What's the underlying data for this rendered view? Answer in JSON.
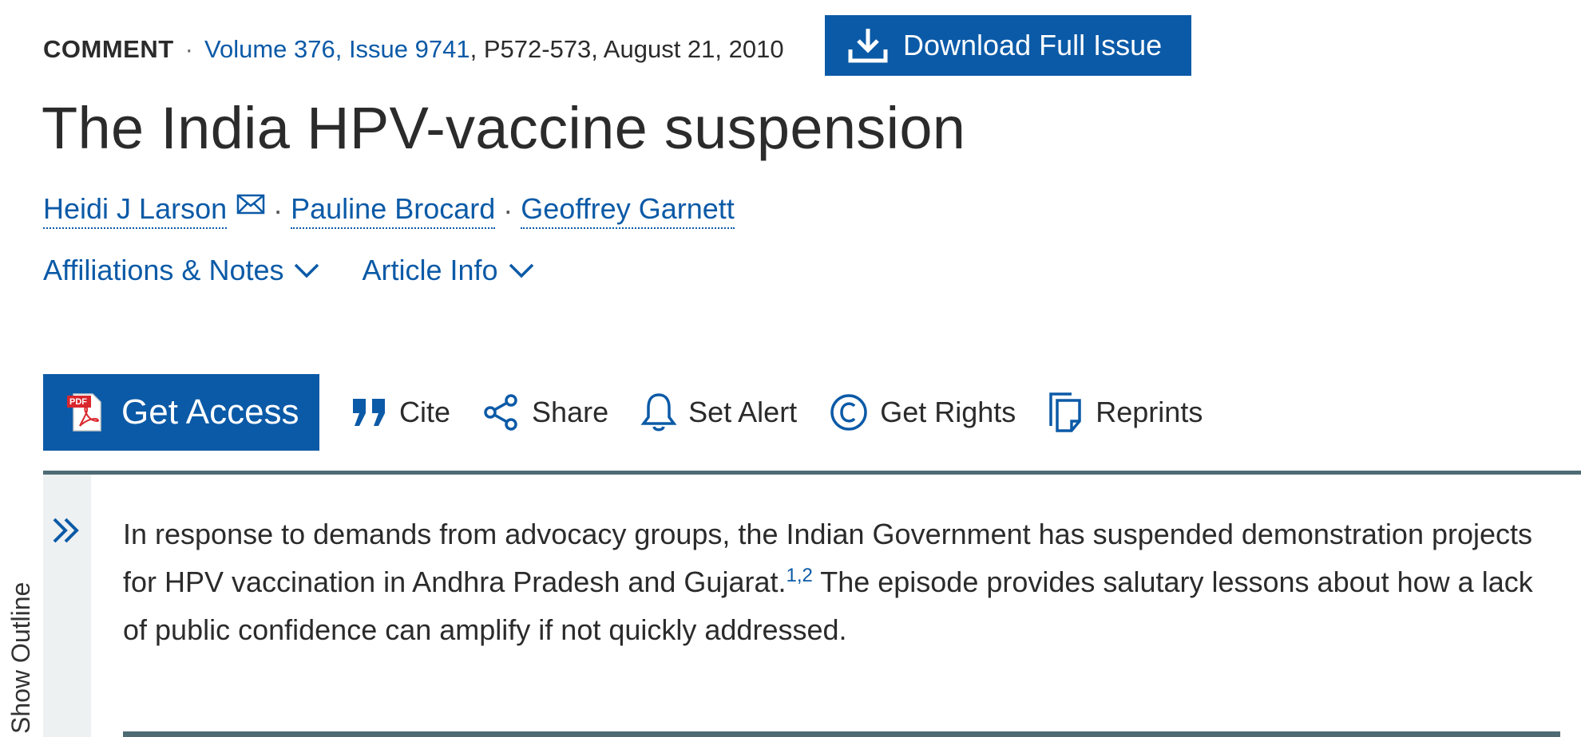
{
  "meta": {
    "type": "COMMENT",
    "separator": "·",
    "volume_issue": "Volume 376, Issue 9741",
    "pages_date": ", P572-573, August 21, 2010"
  },
  "download": {
    "label": "Download Full Issue",
    "icon": "download-icon"
  },
  "title": "The India HPV-vaccine suspension",
  "authors": [
    {
      "name": "Heidi J Larson",
      "has_email": true
    },
    {
      "name": "Pauline Brocard"
    },
    {
      "name": "Geoffrey Garnett"
    }
  ],
  "author_separator": "·",
  "info_links": [
    {
      "label": "Affiliations & Notes"
    },
    {
      "label": "Article Info"
    }
  ],
  "toolbar": {
    "get_access": "Get Access",
    "pdf_badge": "PDF",
    "cite": "Cite",
    "share": "Share",
    "set_alert": "Set Alert",
    "get_rights": "Get Rights",
    "reprints": "Reprints"
  },
  "outline": {
    "label": "Show Outline"
  },
  "abstract": {
    "part1": "In response to demands from advocacy groups, the Indian Government has suspended demonstration projects for HPV vaccination in Andhra Pradesh and Gujarat.",
    "refs": "1,2",
    "part2": " The episode provides salutary lessons about how a lack of public confidence can amplify if not quickly addressed."
  },
  "colors": {
    "brand": "#0b5aa7",
    "rule": "#4e6b74",
    "text": "#2b2b2b"
  }
}
